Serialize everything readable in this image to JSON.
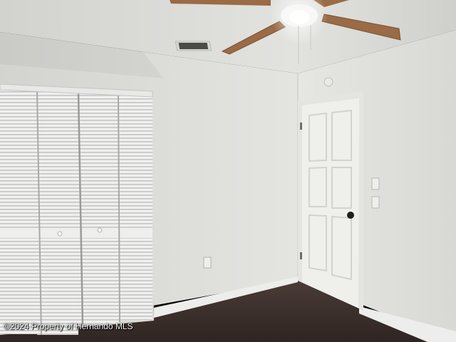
{
  "photo": {
    "watermark": "©2024 Property of Hernando MLS",
    "colors": {
      "ceiling": "#dcdcd9",
      "wall_left": "#dededb",
      "wall_right": "#e7e7e4",
      "carpet": "#3b2e2a",
      "trim": "#ececea",
      "door": "#efefec",
      "fan_blade": "#9a6b44"
    }
  }
}
